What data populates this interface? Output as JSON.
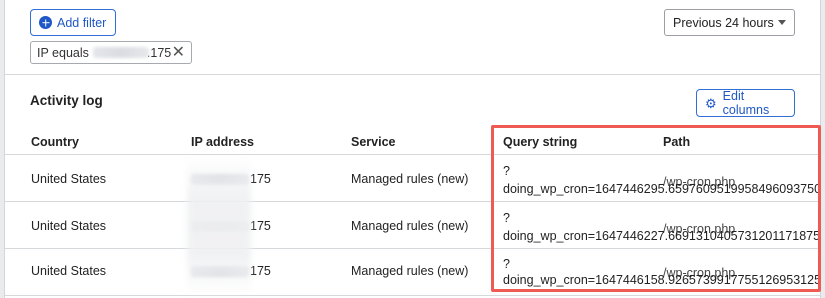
{
  "toolbar": {
    "add_filter_label": "Add filter",
    "range_select_value": "Previous 24 hours"
  },
  "filter_chip": {
    "prefix": "IP equals",
    "ip_suffix": ".175"
  },
  "activity_log": {
    "title": "Activity log",
    "edit_columns_label": "Edit columns",
    "columns": {
      "country": "Country",
      "ip": "IP address",
      "service": "Service",
      "query": "Query string",
      "path": "Path"
    },
    "rows": [
      {
        "country": "United States",
        "ip_suffix": "175",
        "service": "Managed rules (new)",
        "query_prefix": "?",
        "query_value": "doing_wp_cron=1647446295.6597609519958496093750",
        "path": "/wp-cron.php"
      },
      {
        "country": "United States",
        "ip_suffix": "175",
        "service": "Managed rules (new)",
        "query_prefix": "?",
        "query_value": "doing_wp_cron=1647446227.6691310405731201171875",
        "path": "/wp-cron.php"
      },
      {
        "country": "United States",
        "ip_suffix": "175",
        "service": "Managed rules (new)",
        "query_prefix": "?",
        "query_value": "doing_wp_cron=1647446158.9265739917755126953125",
        "path": "/wp-cron.php"
      }
    ]
  },
  "colors": {
    "accent": "#1e57c7",
    "highlight": "#ee5b52"
  }
}
